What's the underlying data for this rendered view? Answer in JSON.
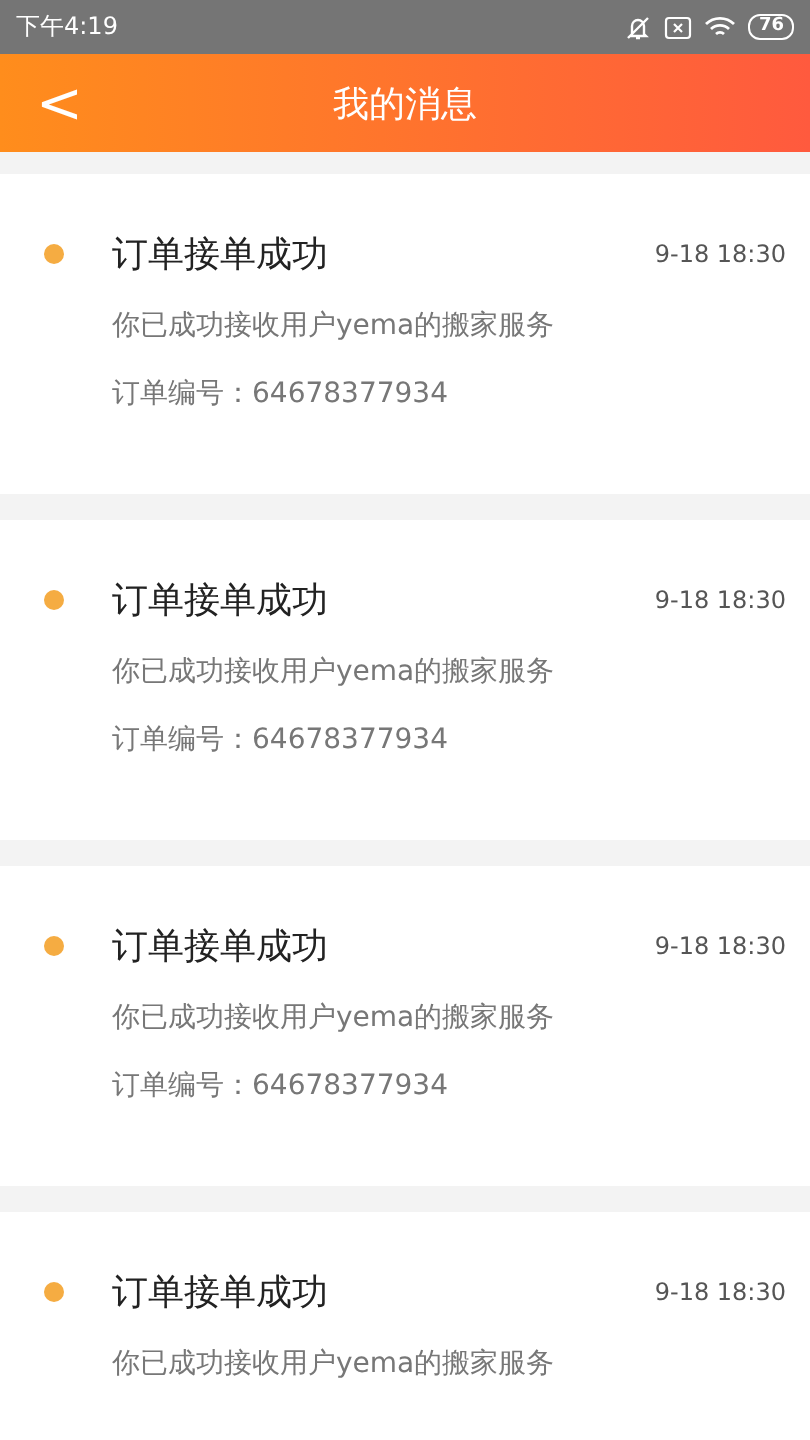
{
  "status_bar": {
    "time": "下午4:19",
    "battery": "76"
  },
  "header": {
    "back": "<",
    "title": "我的消息"
  },
  "messages": [
    {
      "title": "订单接单成功",
      "time": "9-18 18:30",
      "body": "你已成功接收用户yema的搬家服务",
      "order": "订单编号：64678377934",
      "unread": true
    },
    {
      "title": "订单接单成功",
      "time": "9-18 18:30",
      "body": "你已成功接收用户yema的搬家服务",
      "order": "订单编号：64678377934",
      "unread": true
    },
    {
      "title": "订单接单成功",
      "time": "9-18 18:30",
      "body": "你已成功接收用户yema的搬家服务",
      "order": "订单编号：64678377934",
      "unread": true
    },
    {
      "title": "订单接单成功",
      "time": "9-18 18:30",
      "body": "你已成功接收用户yema的搬家服务",
      "unread": true
    }
  ]
}
